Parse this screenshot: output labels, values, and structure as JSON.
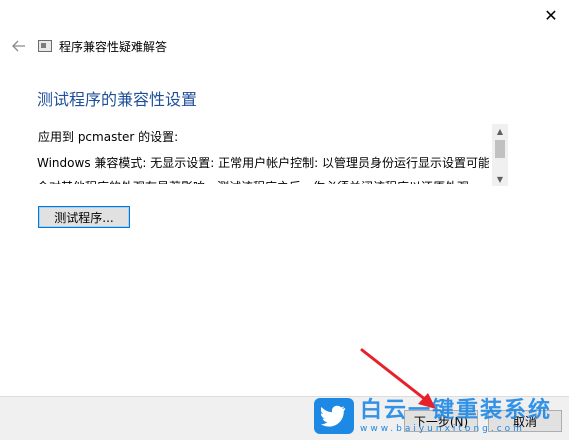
{
  "window": {
    "close_glyph": "✕",
    "title": "程序兼容性疑难解答"
  },
  "main": {
    "heading": "测试程序的兼容性设置",
    "section_label": "应用到 pcmaster 的设置:",
    "info_lines": [
      "Windows 兼容模式: 无显示设置: 正常用户帐户控制: 以管理员身份运行显示设置可能",
      "会对其他程序的外观有显著影响。测试该程序之后，你必须关闭该程序以还原外观"
    ],
    "test_button_label": "测试程序..."
  },
  "footer": {
    "next_label": "下一步(N)",
    "cancel_label": "取消"
  },
  "watermark": {
    "text": "白云一键重装系统",
    "url": "www.baiyunxitong.com"
  },
  "colors": {
    "heading": "#1f4f9a",
    "accent": "#0078d7",
    "footer_bg": "#f0f0f0",
    "annotation_arrow": "#e8202a",
    "watermark": "#1e88e5"
  }
}
